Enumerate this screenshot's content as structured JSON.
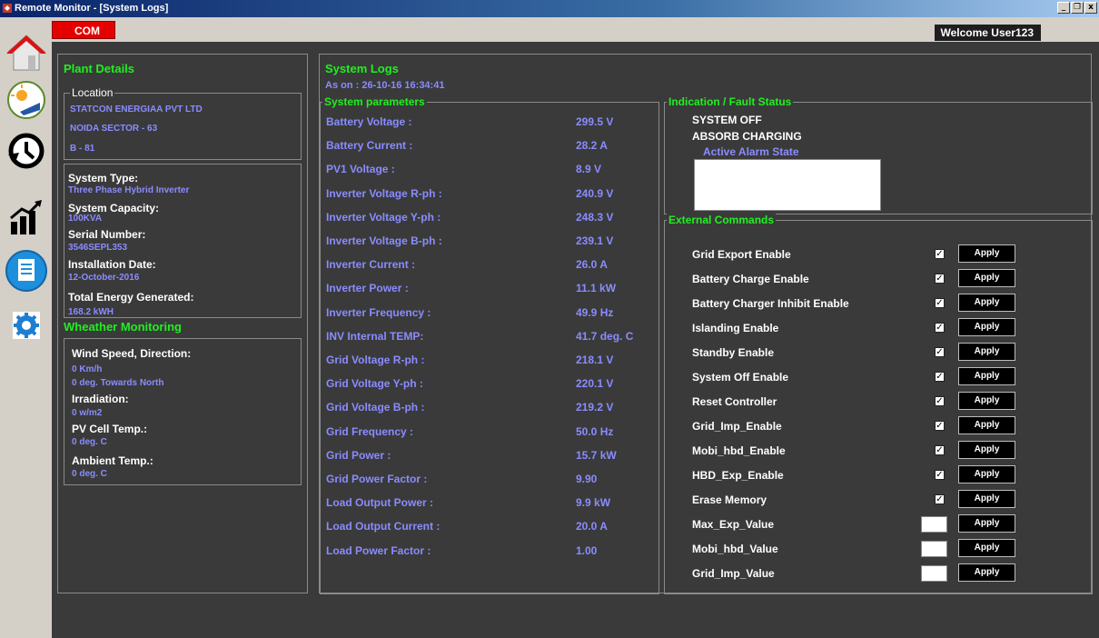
{
  "window": {
    "title": "Remote Monitor - [System Logs]",
    "buttons": [
      "_",
      "8",
      "x"
    ]
  },
  "topbar": {
    "com_label": "COM",
    "welcome": "Welcome User123"
  },
  "sidebar": {
    "items": [
      {
        "icon": "home-icon"
      },
      {
        "icon": "solar-panel-icon"
      },
      {
        "icon": "history-clock-icon"
      },
      {
        "icon": "chart-icon"
      },
      {
        "icon": "document-icon"
      },
      {
        "icon": "settings-icon"
      }
    ]
  },
  "plant": {
    "title": "Plant Details",
    "location_legend": "Location",
    "location_lines": [
      "STATCON ENERGIAA PVT LTD",
      "NOIDA SECTOR - 63",
      "B - 81"
    ],
    "fields": [
      {
        "label": "System Type:",
        "value": "Three Phase Hybrid Inverter"
      },
      {
        "label": "System Capacity:",
        "value": "100KVA"
      },
      {
        "label": "Serial Number:",
        "value": "3546SEPL353"
      },
      {
        "label": "Installation Date:",
        "value": "12-October-2016"
      },
      {
        "label": "Total Energy Generated:",
        "value": "168.2 kWH"
      }
    ]
  },
  "weather": {
    "title": "Wheather Monitoring",
    "wind_label": "Wind Speed, Direction:",
    "wind_speed": "0 Km/h",
    "wind_dir": "0 deg. Towards North",
    "irr_label": "Irradiation:",
    "irr_value": "0 w/m2",
    "pv_label": "PV Cell Temp.:",
    "pv_value": "0 deg. C",
    "amb_label": "Ambient Temp.:",
    "amb_value": "0 deg. C"
  },
  "syslogs": {
    "title": "System Logs",
    "as_on": "As on : 26-10-16 16:34:41"
  },
  "params": {
    "legend": "System parameters",
    "rows": [
      {
        "label": "Battery Voltage :",
        "value": "299.5 V"
      },
      {
        "label": "Battery Current :",
        "value": "28.2 A"
      },
      {
        "label": "PV1 Voltage :",
        "value": "8.9 V"
      },
      {
        "label": "Inverter Voltage R-ph :",
        "value": "240.9 V"
      },
      {
        "label": "Inverter Voltage Y-ph :",
        "value": "248.3 V"
      },
      {
        "label": "Inverter Voltage B-ph :",
        "value": "239.1 V"
      },
      {
        "label": "Inverter Current :",
        "value": "26.0 A"
      },
      {
        "label": "Inverter Power :",
        "value": "11.1 kW"
      },
      {
        "label": "Inverter Frequency :",
        "value": "49.9 Hz"
      },
      {
        "label": "INV Internal TEMP:",
        "value": "41.7 deg. C"
      },
      {
        "label": "Grid Voltage R-ph :",
        "value": "218.1 V"
      },
      {
        "label": "Grid Voltage Y-ph :",
        "value": "220.1 V"
      },
      {
        "label": "Grid Voltage B-ph :",
        "value": "219.2 V"
      },
      {
        "label": "Grid Frequency :",
        "value": "50.0 Hz"
      },
      {
        "label": "Grid Power :",
        "value": "15.7 kW"
      },
      {
        "label": "Grid Power Factor :",
        "value": "9.90"
      },
      {
        "label": "Load Output Power :",
        "value": "9.9 kW"
      },
      {
        "label": "Load Output Current :",
        "value": "20.0 A"
      },
      {
        "label": "Load  Power Factor :",
        "value": "1.00"
      }
    ]
  },
  "indication": {
    "legend": "Indication / Fault Status",
    "status1": "SYSTEM OFF",
    "status2": "ABSORB CHARGING",
    "alarm_label": "Active Alarm State"
  },
  "commands": {
    "legend": "External Commands",
    "apply_label": "Apply",
    "rows": [
      {
        "label": "Grid Export Enable",
        "kind": "checkbox",
        "checked": true
      },
      {
        "label": "Battery Charge Enable",
        "kind": "checkbox",
        "checked": true
      },
      {
        "label": "Battery Charger Inhibit Enable",
        "kind": "checkbox",
        "checked": true
      },
      {
        "label": "Islanding Enable",
        "kind": "checkbox",
        "checked": true
      },
      {
        "label": "Standby Enable",
        "kind": "checkbox",
        "checked": true
      },
      {
        "label": "System Off Enable",
        "kind": "checkbox",
        "checked": true
      },
      {
        "label": "Reset Controller",
        "kind": "checkbox",
        "checked": true
      },
      {
        "label": "Grid_Imp_Enable",
        "kind": "checkbox",
        "checked": true
      },
      {
        "label": "Mobi_hbd_Enable",
        "kind": "checkbox",
        "checked": true
      },
      {
        "label": "HBD_Exp_Enable",
        "kind": "checkbox",
        "checked": true
      },
      {
        "label": "Erase Memory",
        "kind": "checkbox",
        "checked": true
      },
      {
        "label": "Max_Exp_Value",
        "kind": "input",
        "value": ""
      },
      {
        "label": "Mobi_hbd_Value",
        "kind": "input",
        "value": ""
      },
      {
        "label": "Grid_Imp_Value",
        "kind": "input",
        "value": ""
      }
    ]
  },
  "colors": {
    "green_title": "#1ff01f",
    "value_blue": "#8a8cff",
    "panel_bg": "#3a3a3a",
    "com_red": "#e40000"
  }
}
